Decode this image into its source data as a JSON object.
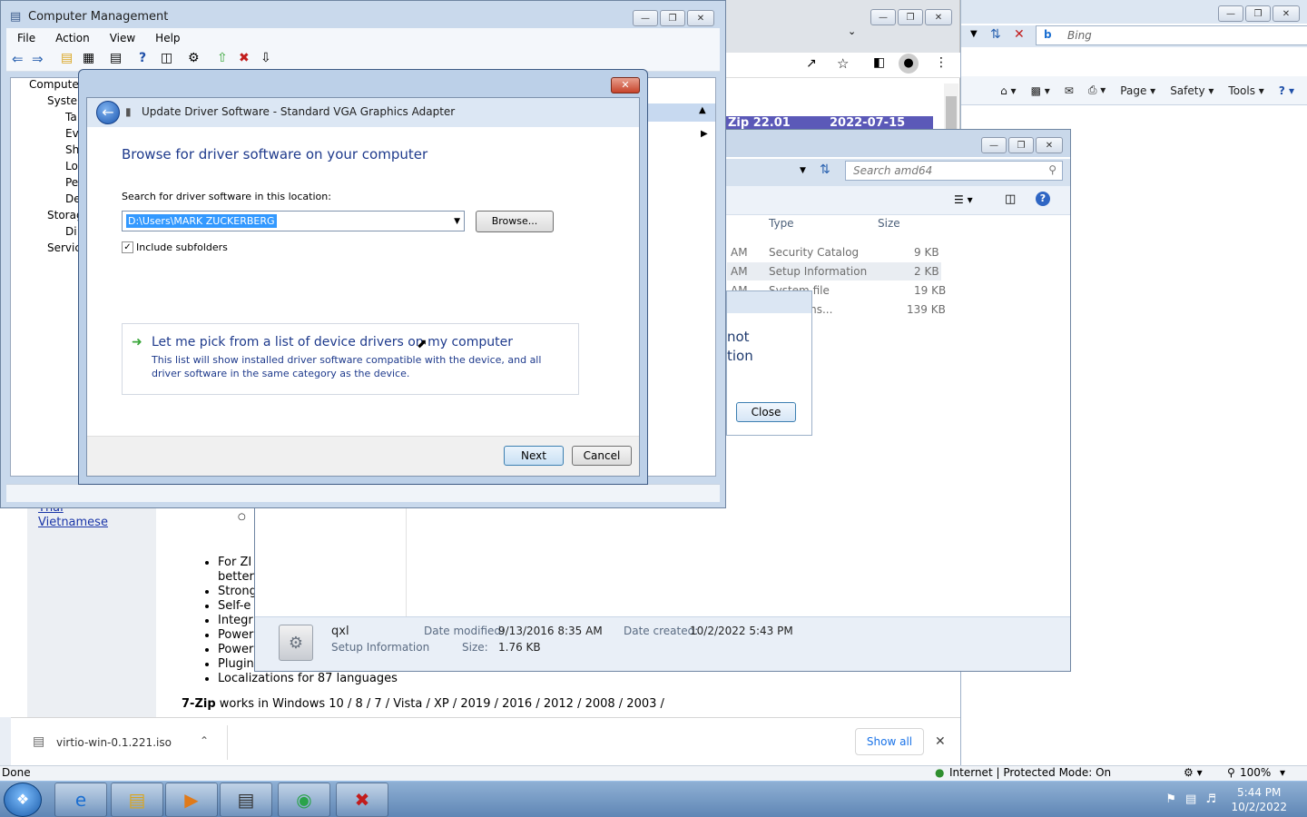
{
  "ie": {
    "search_placeholder": "Bing",
    "cmd_page": "Page",
    "cmd_safety": "Safety",
    "cmd_tools": "Tools",
    "status_done": "Done",
    "status_zone": "Internet | Protected Mode: On",
    "zoom": "100%"
  },
  "webpage": {
    "link_thai": "Thai",
    "link_vietnamese": "Vietnamese",
    "bullets": [
      "For ZI",
      "better",
      "Strong",
      "Self-e",
      "Integr",
      "Power",
      "Power",
      "Plugin",
      "Localizations for 87 languages"
    ],
    "works_bold": "7-Zip",
    "works_text": " works in Windows 10 / 8 / 7 / Vista / XP / 2019 / 2016 / 2012 / 2008 / 2003 /",
    "row1_a": "Zip 22.01",
    "row1_b": "2022-07-15"
  },
  "explorer": {
    "search_placeholder": "Search amd64",
    "col_type": "Type",
    "col_size": "Size",
    "rows": [
      {
        "time": "AM",
        "type": "Security Catalog",
        "size": "9 KB"
      },
      {
        "time": "AM",
        "type": "Setup Information",
        "size": "2 KB"
      },
      {
        "time": "AM",
        "type": "System file",
        "size": "19 KB"
      },
      {
        "time": "",
        "type": "on extens...",
        "size": "139 KB"
      }
    ],
    "details": {
      "name": "qxl",
      "kind": "Setup Information",
      "modified_label": "Date modified:",
      "modified_value": "9/13/2016 8:35 AM",
      "created_label": "Date created:",
      "created_value": "10/2/2022 5:43 PM",
      "size_label": "Size:",
      "size_value": "1.76 KB"
    }
  },
  "errdlg": {
    "line1": "not",
    "line2": "tion",
    "close_label": "Close"
  },
  "compmgmt": {
    "title": "Computer Management",
    "menu": [
      "File",
      "Action",
      "View",
      "Help"
    ],
    "tree": [
      "Compute",
      "Syste",
      "Ta",
      "Ev",
      "Sh",
      "Lo",
      "Pe",
      "De",
      "Storag",
      "Di",
      "Servic"
    ]
  },
  "wizard": {
    "title": "Update Driver Software - Standard VGA Graphics Adapter",
    "heading": "Browse for driver software on your computer",
    "location_label": "Search for driver software in this location:",
    "location_value": "D:\\Users\\MARK ZUCKERBERG",
    "browse_label": "Browse...",
    "include_label": "Include subfolders",
    "pick_title": "Let me pick from a list of device drivers on my computer",
    "pick_desc": "This list will show installed driver software compatible with the device, and all driver software in the same category as the device.",
    "next_label": "Next",
    "cancel_label": "Cancel"
  },
  "download": {
    "file": "virtio-win-0.1.221.iso",
    "show_all": "Show all"
  },
  "taskbar": {
    "time": "5:44 PM",
    "date": "10/2/2022"
  }
}
